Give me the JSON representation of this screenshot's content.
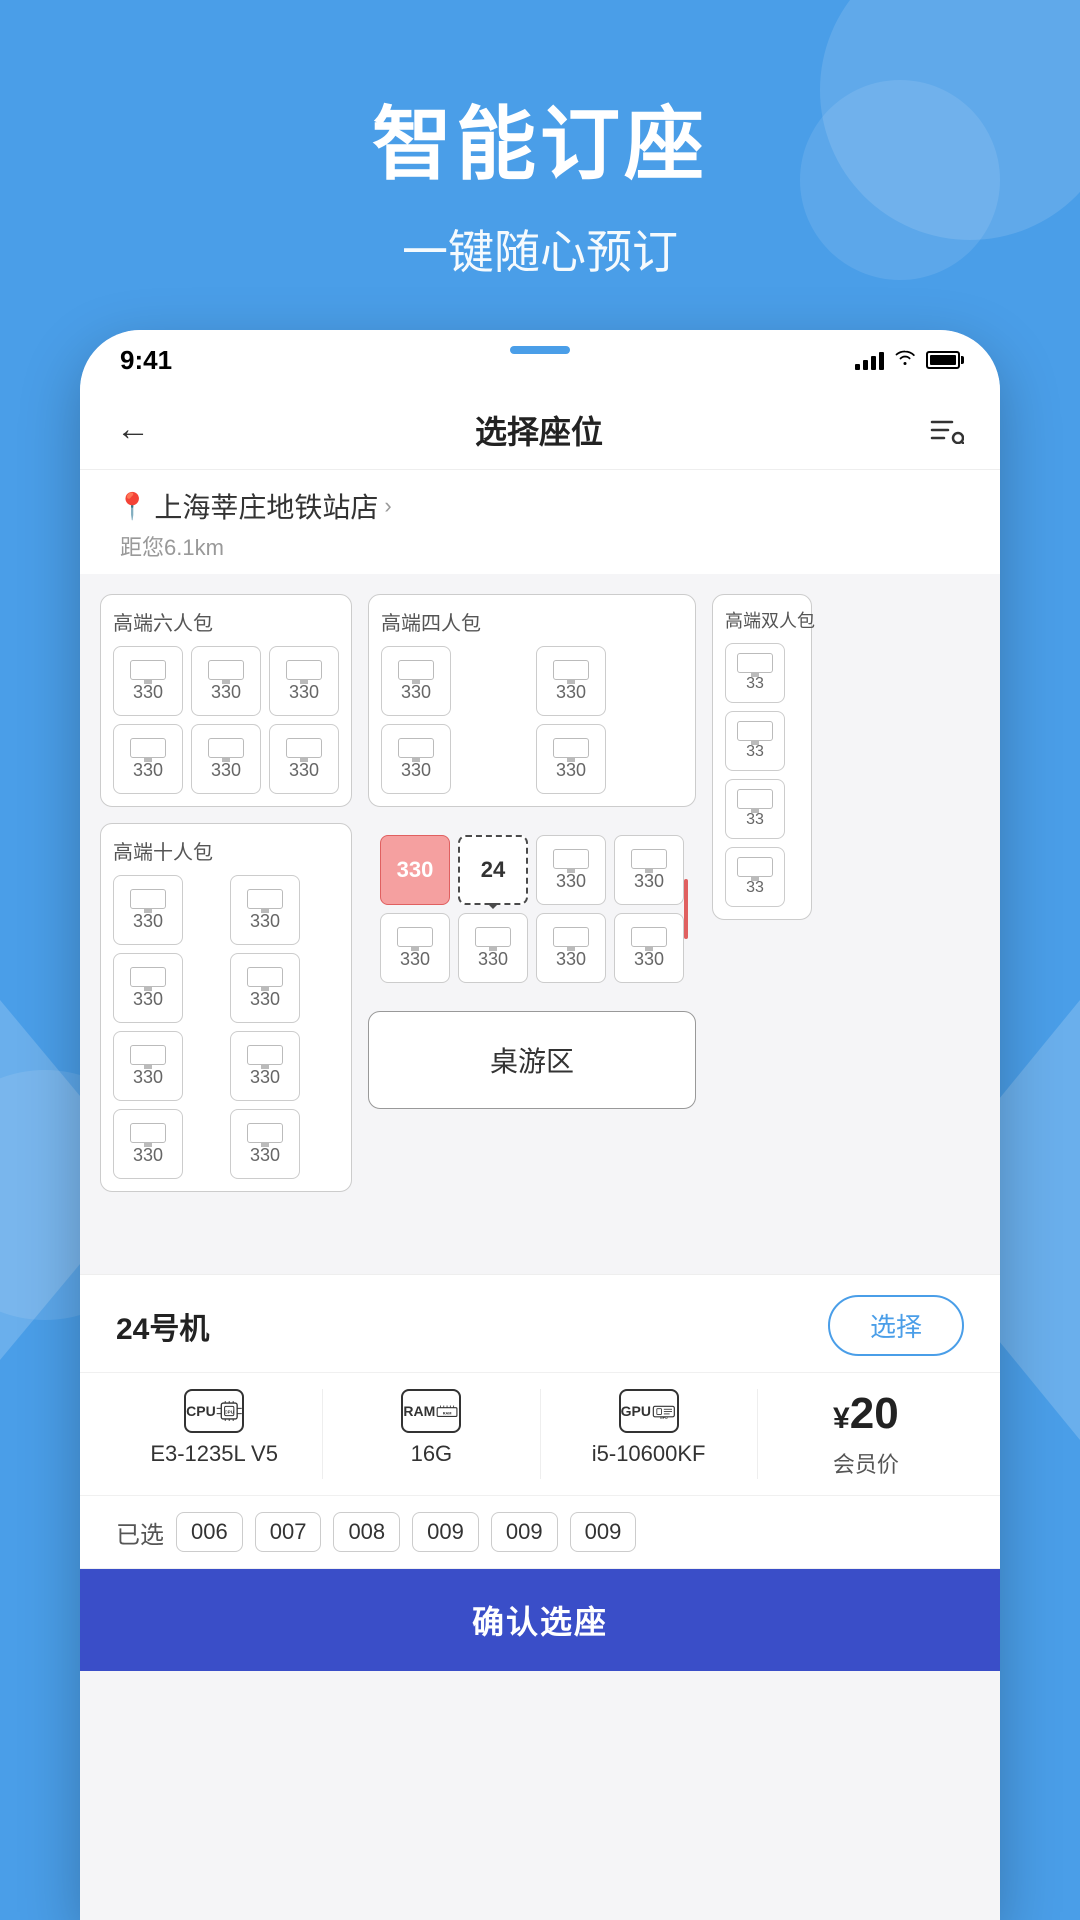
{
  "background": {
    "color": "#4A9EE8"
  },
  "hero": {
    "title": "智能订座",
    "subtitle": "一键随心预订"
  },
  "status_bar": {
    "time": "9:41",
    "signal": "signal",
    "wifi": "wifi",
    "battery": "battery"
  },
  "nav": {
    "title": "选择座位",
    "back_label": "←",
    "right_icon": "filter-search"
  },
  "location": {
    "pin_icon": "📍",
    "name": "上海莘庄地铁站店",
    "chevron": ">",
    "distance": "距您6.1km"
  },
  "rooms": [
    {
      "id": "room-6",
      "label": "高端六人包",
      "seats": [
        "330",
        "330",
        "330",
        "330",
        "330",
        "330"
      ]
    },
    {
      "id": "room-4",
      "label": "高端四人包",
      "seats": [
        "330",
        "330",
        "330",
        "330"
      ]
    },
    {
      "id": "room-2",
      "label": "高端双人包",
      "seats": [
        "33",
        "33"
      ]
    }
  ],
  "room_10": {
    "label": "高端十人包",
    "left_seats": [
      "330",
      "330",
      "330",
      "330",
      "330",
      "330"
    ],
    "right_seats_top": [
      {
        "num": "330",
        "state": "occupied"
      },
      {
        "num": "24",
        "state": "selected"
      },
      {
        "num": "330",
        "state": "normal"
      },
      {
        "num": "330",
        "state": "normal"
      }
    ],
    "right_seats_bottom": [
      "330",
      "330",
      "330",
      "330"
    ]
  },
  "board_game_area": {
    "label": "桌游区"
  },
  "machine_info": {
    "name": "24号机",
    "select_button": "选择"
  },
  "specs": {
    "cpu": {
      "icon_label": "CPU",
      "value": "E3-1235L V5"
    },
    "ram": {
      "icon_label": "RAM",
      "value": "16G"
    },
    "gpu": {
      "icon_label": "GPU",
      "value": "i5-10600KF"
    },
    "price": {
      "symbol": "¥",
      "value": "20",
      "label": "会员价"
    }
  },
  "selected_seats": {
    "label": "已选",
    "items": [
      "006",
      "007",
      "008",
      "009",
      "009",
      "009"
    ]
  },
  "confirm_button": {
    "label": "确认选座"
  }
}
